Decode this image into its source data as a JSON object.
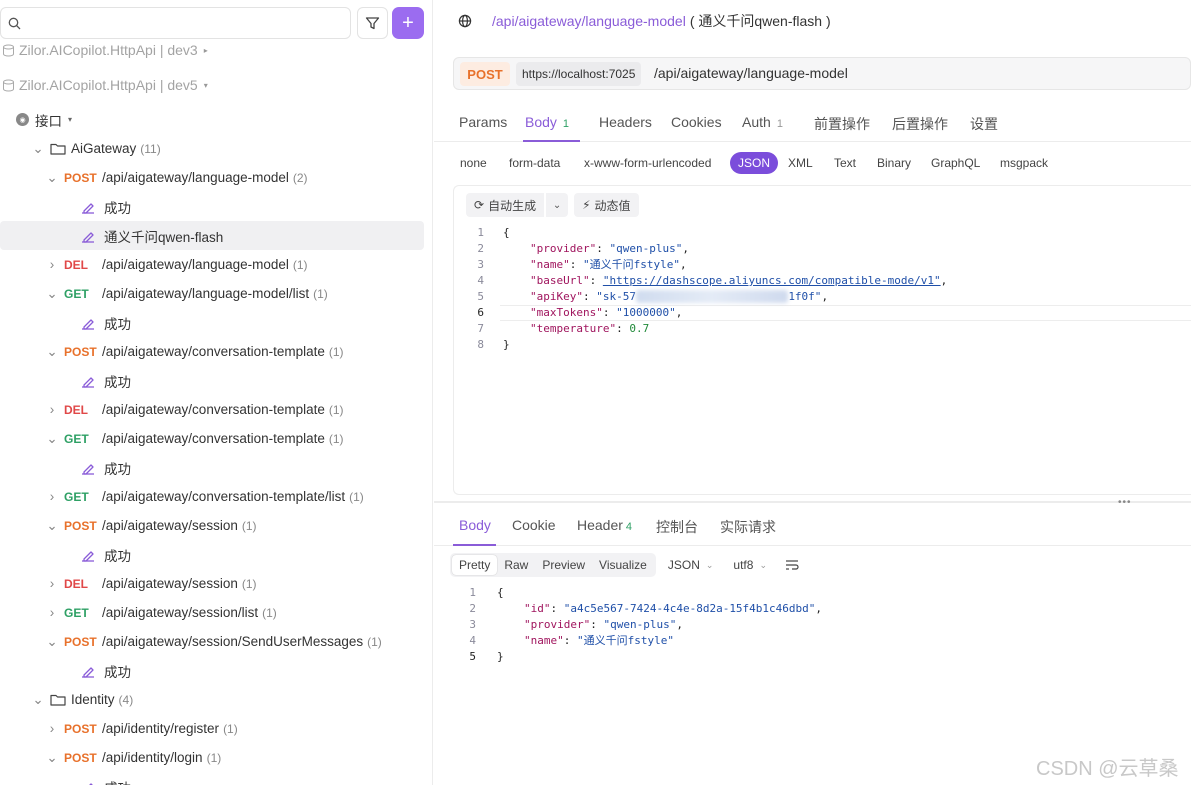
{
  "sidebar": {
    "search_placeholder": "",
    "projects": [
      {
        "label": "Zilor.AICopilot.HttpApi | dev3"
      },
      {
        "label": "Zilor.AICopilot.HttpApi | dev5"
      }
    ],
    "root": {
      "label": "接口"
    },
    "tree": [
      {
        "kind": "folder",
        "label": "AiGateway",
        "count": "(11)"
      },
      {
        "kind": "api",
        "method": "POST",
        "path": "/api/aigateway/language-model",
        "count": "(2)"
      },
      {
        "kind": "case",
        "label": "成功"
      },
      {
        "kind": "case",
        "label": "通义千问qwen-flash"
      },
      {
        "kind": "api",
        "method": "DEL",
        "path": "/api/aigateway/language-model",
        "count": "(1)"
      },
      {
        "kind": "api",
        "method": "GET",
        "path": "/api/aigateway/language-model/list",
        "count": "(1)"
      },
      {
        "kind": "case",
        "label": "成功"
      },
      {
        "kind": "api",
        "method": "POST",
        "path": "/api/aigateway/conversation-template",
        "count": "(1)"
      },
      {
        "kind": "case",
        "label": "成功"
      },
      {
        "kind": "api",
        "method": "DEL",
        "path": "/api/aigateway/conversation-template",
        "count": "(1)"
      },
      {
        "kind": "api",
        "method": "GET",
        "path": "/api/aigateway/conversation-template",
        "count": "(1)"
      },
      {
        "kind": "case",
        "label": "成功"
      },
      {
        "kind": "api",
        "method": "GET",
        "path": "/api/aigateway/conversation-template/list",
        "count": "(1)"
      },
      {
        "kind": "api",
        "method": "POST",
        "path": "/api/aigateway/session",
        "count": "(1)"
      },
      {
        "kind": "case",
        "label": "成功"
      },
      {
        "kind": "api",
        "method": "DEL",
        "path": "/api/aigateway/session",
        "count": "(1)"
      },
      {
        "kind": "api",
        "method": "GET",
        "path": "/api/aigateway/session/list",
        "count": "(1)"
      },
      {
        "kind": "api",
        "method": "POST",
        "path": "/api/aigateway/session/SendUserMessages",
        "count": "(1)"
      },
      {
        "kind": "case",
        "label": "成功"
      },
      {
        "kind": "folder",
        "label": "Identity",
        "count": "(4)"
      },
      {
        "kind": "api",
        "method": "POST",
        "path": "/api/identity/register",
        "count": "(1)"
      },
      {
        "kind": "api",
        "method": "POST",
        "path": "/api/identity/login",
        "count": "(1)"
      },
      {
        "kind": "case",
        "label": "成功"
      }
    ]
  },
  "tab": {
    "path": "/api/aigateway/language-model",
    "suffix": "( 通义千问qwen-flash )"
  },
  "request": {
    "method": "POST",
    "base_url": "https://localhost:7025",
    "path": "/api/aigateway/language-model",
    "tabs": [
      "Params",
      "Body",
      "Headers",
      "Cookies",
      "Auth",
      "前置操作",
      "后置操作",
      "设置"
    ],
    "tab_badges": {
      "body": "1",
      "auth": "1"
    },
    "body_types": [
      "none",
      "form-data",
      "x-www-form-urlencoded",
      "JSON",
      "XML",
      "Text",
      "Binary",
      "GraphQL",
      "msgpack"
    ],
    "tools": {
      "auto_generate": "自动生成",
      "dynamic_value": "动态值"
    },
    "body_lines": [
      {
        "n": "1",
        "open": "{"
      },
      {
        "n": "2",
        "key": "\"provider\"",
        "val": "\"qwen-plus\""
      },
      {
        "n": "3",
        "key": "\"name\"",
        "val": "\"通义千问fstyle\""
      },
      {
        "n": "4",
        "key": "\"baseUrl\"",
        "val": "\"https://dashscope.aliyuncs.com/compatible-mode/v1\""
      },
      {
        "n": "5",
        "key": "\"apiKey\"",
        "val_a": "\"sk-57",
        "val_b": "1f0f\""
      },
      {
        "n": "6",
        "key": "\"maxTokens\"",
        "val": "\"1000000\""
      },
      {
        "n": "7",
        "key": "\"temperature\"",
        "num": "0.7"
      },
      {
        "n": "8",
        "close": "}"
      }
    ]
  },
  "response": {
    "tabs": [
      "Body",
      "Cookie",
      "Header",
      "控制台",
      "实际请求"
    ],
    "header_badge": "4",
    "view_modes": [
      "Pretty",
      "Raw",
      "Preview",
      "Visualize"
    ],
    "format": "JSON",
    "encoding": "utf8",
    "body_lines": [
      {
        "n": "1",
        "open": "{"
      },
      {
        "n": "2",
        "key": "\"id\"",
        "val": "\"a4c5e567-7424-4c4e-8d2a-15f4b1c46dbd\""
      },
      {
        "n": "3",
        "key": "\"provider\"",
        "val": "\"qwen-plus\""
      },
      {
        "n": "4",
        "key": "\"name\"",
        "val": "\"通义千问fstyle\""
      },
      {
        "n": "5",
        "close": "}"
      }
    ]
  },
  "watermark": "CSDN @云草桑"
}
